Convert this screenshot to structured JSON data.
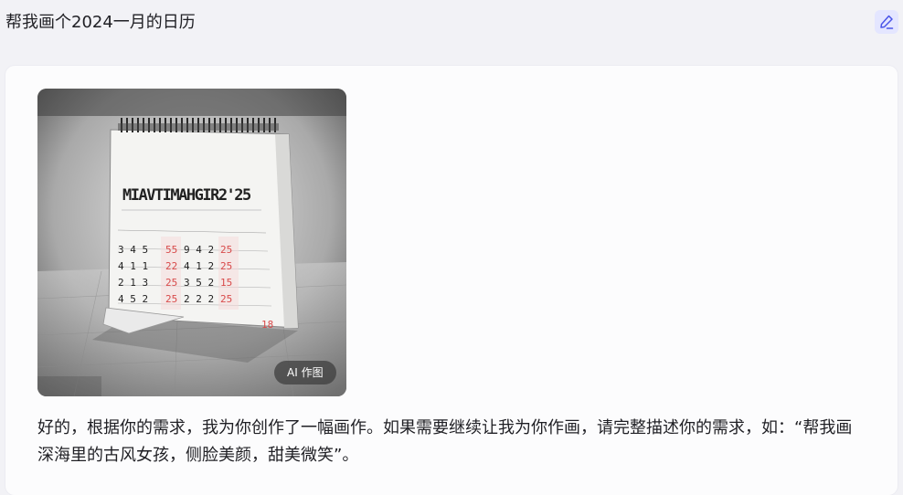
{
  "query": {
    "text": "帮我画个2024一月的日历"
  },
  "icons": {
    "edit": "pencil-edit-icon"
  },
  "colors": {
    "edit_icon": "#4a55e8",
    "edit_bg": "#e4e6ff",
    "page_bg": "#f2f2f6",
    "card_bg": "#fcfcfd"
  },
  "image": {
    "badge": "AI 作图",
    "calendar_heading": "MIAVTIMAHGIR2'25"
  },
  "reply": {
    "text": "好的，根据你的需求，我为你创作了一幅画作。如果需要继续让我为你作画，请完整描述你的需求，如：“帮我画深海里的古风女孩，侧脸美颜，甜美微笑”。"
  }
}
